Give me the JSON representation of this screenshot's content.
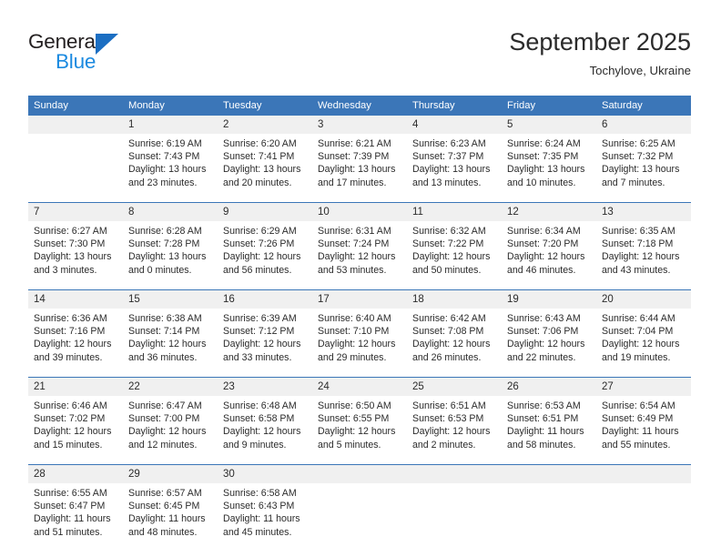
{
  "brand": {
    "name_top": "General",
    "name_bottom": "Blue",
    "triangle_color": "#1b6ec2",
    "blue_text_color": "#1b8ae0"
  },
  "header": {
    "month_title": "September 2025",
    "location": "Tochylove, Ukraine"
  },
  "theme": {
    "header_row_bg": "#3b76b8",
    "daynum_bg": "#f0f0f0",
    "text_color": "#2b2b2b"
  },
  "weekdays": [
    "Sunday",
    "Monday",
    "Tuesday",
    "Wednesday",
    "Thursday",
    "Friday",
    "Saturday"
  ],
  "weeks": [
    [
      {
        "day": "",
        "lines": []
      },
      {
        "day": "1",
        "lines": [
          "Sunrise: 6:19 AM",
          "Sunset: 7:43 PM",
          "Daylight: 13 hours",
          "and 23 minutes."
        ]
      },
      {
        "day": "2",
        "lines": [
          "Sunrise: 6:20 AM",
          "Sunset: 7:41 PM",
          "Daylight: 13 hours",
          "and 20 minutes."
        ]
      },
      {
        "day": "3",
        "lines": [
          "Sunrise: 6:21 AM",
          "Sunset: 7:39 PM",
          "Daylight: 13 hours",
          "and 17 minutes."
        ]
      },
      {
        "day": "4",
        "lines": [
          "Sunrise: 6:23 AM",
          "Sunset: 7:37 PM",
          "Daylight: 13 hours",
          "and 13 minutes."
        ]
      },
      {
        "day": "5",
        "lines": [
          "Sunrise: 6:24 AM",
          "Sunset: 7:35 PM",
          "Daylight: 13 hours",
          "and 10 minutes."
        ]
      },
      {
        "day": "6",
        "lines": [
          "Sunrise: 6:25 AM",
          "Sunset: 7:32 PM",
          "Daylight: 13 hours",
          "and 7 minutes."
        ]
      }
    ],
    [
      {
        "day": "7",
        "lines": [
          "Sunrise: 6:27 AM",
          "Sunset: 7:30 PM",
          "Daylight: 13 hours",
          "and 3 minutes."
        ]
      },
      {
        "day": "8",
        "lines": [
          "Sunrise: 6:28 AM",
          "Sunset: 7:28 PM",
          "Daylight: 13 hours",
          "and 0 minutes."
        ]
      },
      {
        "day": "9",
        "lines": [
          "Sunrise: 6:29 AM",
          "Sunset: 7:26 PM",
          "Daylight: 12 hours",
          "and 56 minutes."
        ]
      },
      {
        "day": "10",
        "lines": [
          "Sunrise: 6:31 AM",
          "Sunset: 7:24 PM",
          "Daylight: 12 hours",
          "and 53 minutes."
        ]
      },
      {
        "day": "11",
        "lines": [
          "Sunrise: 6:32 AM",
          "Sunset: 7:22 PM",
          "Daylight: 12 hours",
          "and 50 minutes."
        ]
      },
      {
        "day": "12",
        "lines": [
          "Sunrise: 6:34 AM",
          "Sunset: 7:20 PM",
          "Daylight: 12 hours",
          "and 46 minutes."
        ]
      },
      {
        "day": "13",
        "lines": [
          "Sunrise: 6:35 AM",
          "Sunset: 7:18 PM",
          "Daylight: 12 hours",
          "and 43 minutes."
        ]
      }
    ],
    [
      {
        "day": "14",
        "lines": [
          "Sunrise: 6:36 AM",
          "Sunset: 7:16 PM",
          "Daylight: 12 hours",
          "and 39 minutes."
        ]
      },
      {
        "day": "15",
        "lines": [
          "Sunrise: 6:38 AM",
          "Sunset: 7:14 PM",
          "Daylight: 12 hours",
          "and 36 minutes."
        ]
      },
      {
        "day": "16",
        "lines": [
          "Sunrise: 6:39 AM",
          "Sunset: 7:12 PM",
          "Daylight: 12 hours",
          "and 33 minutes."
        ]
      },
      {
        "day": "17",
        "lines": [
          "Sunrise: 6:40 AM",
          "Sunset: 7:10 PM",
          "Daylight: 12 hours",
          "and 29 minutes."
        ]
      },
      {
        "day": "18",
        "lines": [
          "Sunrise: 6:42 AM",
          "Sunset: 7:08 PM",
          "Daylight: 12 hours",
          "and 26 minutes."
        ]
      },
      {
        "day": "19",
        "lines": [
          "Sunrise: 6:43 AM",
          "Sunset: 7:06 PM",
          "Daylight: 12 hours",
          "and 22 minutes."
        ]
      },
      {
        "day": "20",
        "lines": [
          "Sunrise: 6:44 AM",
          "Sunset: 7:04 PM",
          "Daylight: 12 hours",
          "and 19 minutes."
        ]
      }
    ],
    [
      {
        "day": "21",
        "lines": [
          "Sunrise: 6:46 AM",
          "Sunset: 7:02 PM",
          "Daylight: 12 hours",
          "and 15 minutes."
        ]
      },
      {
        "day": "22",
        "lines": [
          "Sunrise: 6:47 AM",
          "Sunset: 7:00 PM",
          "Daylight: 12 hours",
          "and 12 minutes."
        ]
      },
      {
        "day": "23",
        "lines": [
          "Sunrise: 6:48 AM",
          "Sunset: 6:58 PM",
          "Daylight: 12 hours",
          "and 9 minutes."
        ]
      },
      {
        "day": "24",
        "lines": [
          "Sunrise: 6:50 AM",
          "Sunset: 6:55 PM",
          "Daylight: 12 hours",
          "and 5 minutes."
        ]
      },
      {
        "day": "25",
        "lines": [
          "Sunrise: 6:51 AM",
          "Sunset: 6:53 PM",
          "Daylight: 12 hours",
          "and 2 minutes."
        ]
      },
      {
        "day": "26",
        "lines": [
          "Sunrise: 6:53 AM",
          "Sunset: 6:51 PM",
          "Daylight: 11 hours",
          "and 58 minutes."
        ]
      },
      {
        "day": "27",
        "lines": [
          "Sunrise: 6:54 AM",
          "Sunset: 6:49 PM",
          "Daylight: 11 hours",
          "and 55 minutes."
        ]
      }
    ],
    [
      {
        "day": "28",
        "lines": [
          "Sunrise: 6:55 AM",
          "Sunset: 6:47 PM",
          "Daylight: 11 hours",
          "and 51 minutes."
        ]
      },
      {
        "day": "29",
        "lines": [
          "Sunrise: 6:57 AM",
          "Sunset: 6:45 PM",
          "Daylight: 11 hours",
          "and 48 minutes."
        ]
      },
      {
        "day": "30",
        "lines": [
          "Sunrise: 6:58 AM",
          "Sunset: 6:43 PM",
          "Daylight: 11 hours",
          "and 45 minutes."
        ]
      },
      {
        "day": "",
        "lines": []
      },
      {
        "day": "",
        "lines": []
      },
      {
        "day": "",
        "lines": []
      },
      {
        "day": "",
        "lines": []
      }
    ]
  ]
}
